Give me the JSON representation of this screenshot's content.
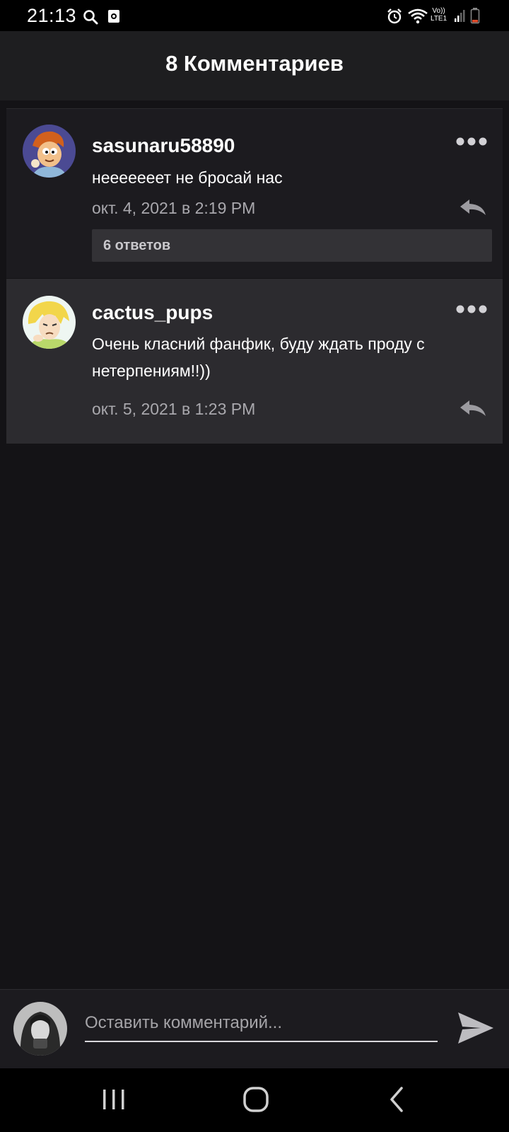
{
  "status_bar": {
    "time": "21:13",
    "icons": [
      "search-icon",
      "screenshot-icon",
      "alarm-icon",
      "wifi-icon",
      "lte-icon",
      "signal-icon",
      "battery-icon"
    ],
    "network_top": "Vo))",
    "network_bottom": "LTE1"
  },
  "header": {
    "title": "8 Комментариев"
  },
  "comments": [
    {
      "username": "sasunaru58890",
      "text": "нееееееет не бросай нас",
      "date": "окт. 4, 2021 в 2:19 PM",
      "replies_label": "6 ответов"
    },
    {
      "username": "cactus_pups",
      "text": "Очень класний фанфик, буду ждать проду с нетерпениям!!))",
      "date": "окт. 5, 2021 в 1:23 PM"
    }
  ],
  "composer": {
    "placeholder": "Оставить комментарий..."
  },
  "colors": {
    "background": "#141316",
    "header": "#1e1e20",
    "comment_alt": "#2c2b2f",
    "muted_text": "#a9a8ad"
  }
}
